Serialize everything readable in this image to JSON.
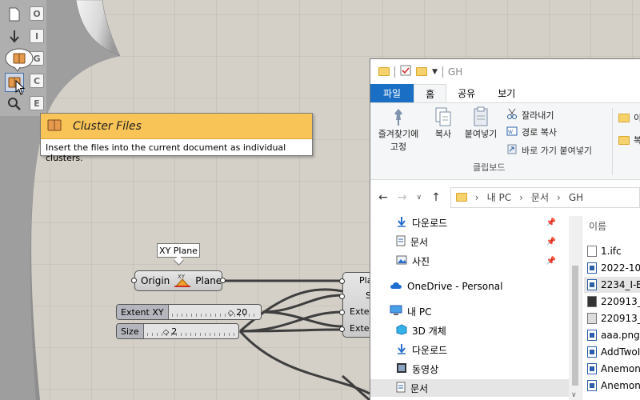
{
  "canvas": {
    "toolbar_letters": [
      "O",
      "I",
      "G",
      "C",
      "E"
    ]
  },
  "tooltip": {
    "title": "Cluster Files",
    "description": "Insert the files into the current document as individual clusters."
  },
  "components": {
    "xy_plane": {
      "label": "XY Plane",
      "input": "Origin",
      "output": "Plane"
    },
    "slider_extent": {
      "name": "Extent XY",
      "value": "20"
    },
    "slider_size": {
      "name": "Size",
      "value": "2"
    },
    "right_component_inputs": [
      "Pla",
      "S",
      "Exten",
      "Exten"
    ]
  },
  "explorer": {
    "title": "GH",
    "tabs": [
      "파일",
      "홈",
      "공유",
      "보기"
    ],
    "active_tab": "홈",
    "ribbon": {
      "pin_label": "즐겨찾기에\n고정",
      "copy_label": "복사",
      "paste_label": "붙여넣기",
      "cut_label": "잘라내기",
      "copy_path_label": "경로 복사",
      "paste_shortcut_label": "바로 가기 붙여넣기",
      "group_label": "클립보드",
      "next_group_first": "이",
      "next_group_second": "복"
    },
    "address": {
      "crumbs": [
        "내 PC",
        "문서",
        "GH"
      ]
    },
    "nav": {
      "items": [
        {
          "label": "다운로드",
          "icon": "download-icon",
          "pinned": true
        },
        {
          "label": "문서",
          "icon": "document-icon",
          "pinned": true
        },
        {
          "label": "사진",
          "icon": "pictures-icon",
          "pinned": true
        },
        {
          "label": "OneDrive - Personal",
          "icon": "cloud-icon",
          "pinned": false
        },
        {
          "label": "내 PC",
          "icon": "pc-icon",
          "pinned": false
        },
        {
          "label": "3D 개체",
          "icon": "3d-objects-icon",
          "pinned": false
        },
        {
          "label": "다운로드",
          "icon": "download-icon",
          "pinned": false
        },
        {
          "label": "동영상",
          "icon": "video-icon",
          "pinned": false
        },
        {
          "label": "문서",
          "icon": "document-icon",
          "pinned": false
        }
      ]
    },
    "files": {
      "column_header": "이름",
      "items": [
        "1.ifc",
        "2022-10",
        "2234_I-B",
        "220913_",
        "220913_",
        "aaa.png",
        "AddTwoI",
        "Anemon",
        "Anemon"
      ]
    }
  }
}
